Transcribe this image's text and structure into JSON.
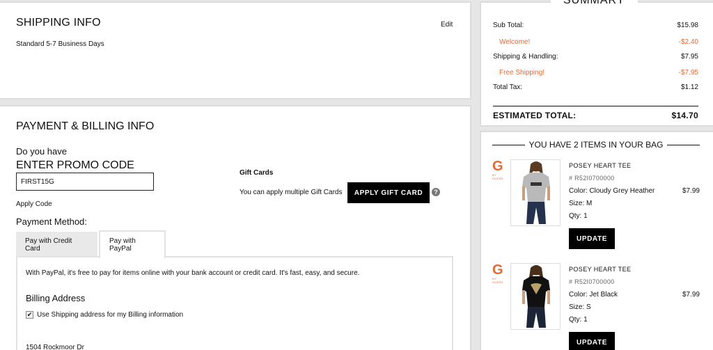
{
  "shipping": {
    "title": "SHIPPING INFO",
    "edit_label": "Edit",
    "method": "Standard 5-7 Business Days"
  },
  "payment": {
    "title": "PAYMENT & BILLING INFO",
    "promo_lead": "Do you have",
    "promo_heading": "ENTER PROMO CODE",
    "promo_value": "FIRST15G",
    "apply_code_label": "Apply Code",
    "gift_title": "Gift Cards",
    "gift_text": "You can apply multiple Gift Cards",
    "gift_button": "APPLY GIFT CARD",
    "help_glyph": "?",
    "method_label": "Payment Method:",
    "tabs": [
      {
        "label": "Pay with Credit Card",
        "active": false
      },
      {
        "label": "Pay with PayPal",
        "active": true
      }
    ],
    "paypal_text": "With PayPal, it's free to pay for items online with your bank account or credit card. It's fast, easy, and secure.",
    "billing_title": "Billing Address",
    "use_shipping_label": "Use Shipping address for my Billing information",
    "use_shipping_checked": true,
    "checkmark": "✔",
    "address_line": "1504 Rockmoor Dr"
  },
  "summary": {
    "title": "SUMMARY",
    "rows": [
      {
        "label": "Sub Total:",
        "value": "$15.98"
      },
      {
        "label": "Welcome!",
        "value": "-$2.40"
      },
      {
        "label": "Shipping & Handling:",
        "value": "$7.95"
      },
      {
        "label": "Free Shipping!",
        "value": "-$7.95"
      },
      {
        "label": "Total Tax:",
        "value": "$1.12"
      }
    ],
    "estimated_label": "ESTIMATED TOTAL:",
    "estimated_value": "$14.70",
    "accent_color": "#e06b3b"
  },
  "bag": {
    "heading": "YOU HAVE 2 ITEMS IN YOUR BAG",
    "items": [
      {
        "brand": "G",
        "brand_sub": "BY GUESS",
        "name": "POSEY HEART TEE",
        "sku": "# R52I0700000",
        "color": "Color: Cloudy Grey Heather",
        "size": "Size: M",
        "qty": "Qty: 1",
        "price": "$7.99",
        "update_label": "UPDATE"
      },
      {
        "brand": "G",
        "brand_sub": "BY GUESS",
        "name": "POSEY HEART TEE",
        "sku": "# R52I0700000",
        "color": "Color: Jet Black",
        "size": "Size: S",
        "qty": "Qty: 1",
        "price": "$7.99",
        "update_label": "UPDATE"
      }
    ]
  }
}
